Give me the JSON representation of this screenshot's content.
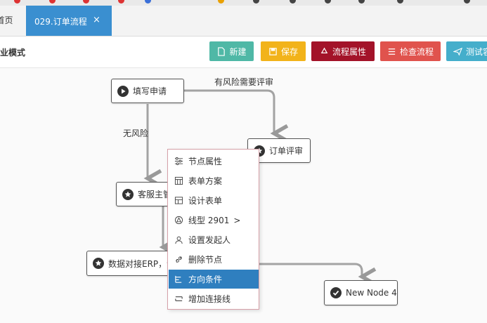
{
  "tabs": {
    "home_label": "首页",
    "active_label": "029.订单流程",
    "close_symbol": "×"
  },
  "toolbar": {
    "mode_label": "专业模式",
    "buttons": [
      {
        "label": "新建",
        "icon": "new-file-icon",
        "color": "#4fb8a6"
      },
      {
        "label": "保存",
        "icon": "save-icon",
        "color": "#f2b31a"
      },
      {
        "label": "流程属性",
        "icon": "recycle-icon",
        "color": "#a31329"
      },
      {
        "label": "检查流程",
        "icon": "list-check-icon",
        "color": "#e0534d"
      },
      {
        "label": "测试容",
        "icon": "send-icon",
        "color": "#45aecb"
      }
    ]
  },
  "flow": {
    "nodes": [
      {
        "label": "填写申请",
        "icon": "play-icon"
      },
      {
        "label": "订单评审",
        "icon": "star-icon"
      },
      {
        "label": "客服主管",
        "icon": "star-icon"
      },
      {
        "label": "数据对接ERP，订单生成，展工单",
        "icon": "star-icon"
      },
      {
        "label": "New Node 4",
        "icon": "check-icon"
      }
    ],
    "edge_labels": [
      "有风险需要评审",
      "无风险"
    ]
  },
  "context_menu": {
    "items": [
      {
        "label": "节点属性",
        "icon": "sliders-icon"
      },
      {
        "label": "表单方案",
        "icon": "form-grid-icon"
      },
      {
        "label": "设计表单",
        "icon": "design-form-icon"
      },
      {
        "label": "线型 2901",
        "icon": "line-type-icon",
        "submenu": true
      },
      {
        "label": "设置发起人",
        "icon": "user-icon"
      },
      {
        "label": "删除节点",
        "icon": "unlink-icon"
      },
      {
        "label": "方向条件",
        "icon": "direction-icon",
        "highlighted": true
      },
      {
        "label": "增加连接线",
        "icon": "connector-icon"
      }
    ],
    "submenu_symbol": ">",
    "highlight_color": "#2f7fbf"
  }
}
